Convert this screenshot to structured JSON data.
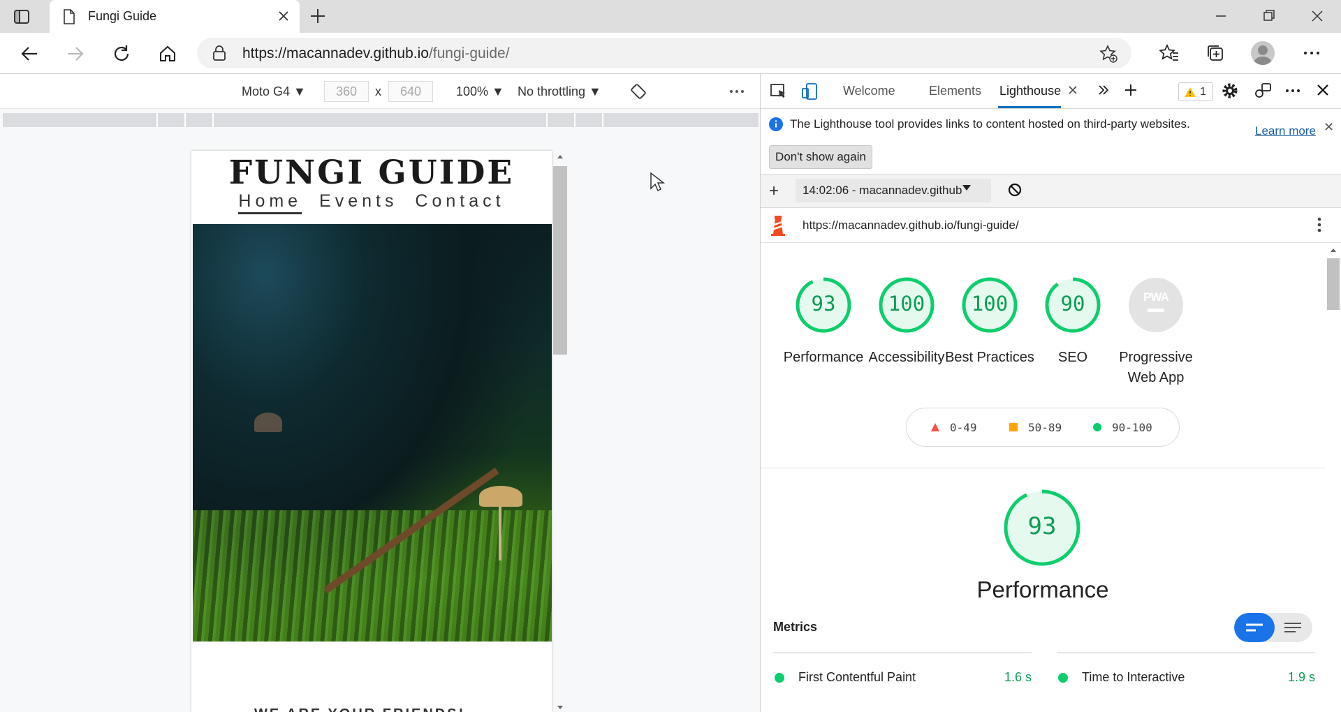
{
  "browser": {
    "tab_title": "Fungi Guide",
    "url_host": "https://macannadev.github.io",
    "url_path": "/fungi-guide/"
  },
  "device_toolbar": {
    "device": "Moto G4 ▼",
    "width": "360",
    "height": "640",
    "times": "x",
    "zoom": "100% ▼",
    "throttling": "No throttling ▼"
  },
  "site": {
    "title": "FUNGI GUIDE",
    "nav": [
      "Home",
      "Events",
      "Contact"
    ],
    "below_fold": "WE ARE YOUR FRIENDS!"
  },
  "devtools": {
    "tabs": {
      "welcome": "Welcome",
      "elements": "Elements",
      "lighthouse": "Lighthouse"
    },
    "warning_count": "1",
    "info_text": "The Lighthouse tool provides links to content hosted on third-party websites.",
    "learn_more": "Learn more",
    "dont_show": "Don't show again",
    "report_select": "14:02:06 - macannadev.github",
    "report_url": "https://macannadev.github.io/fungi-guide/",
    "scores": [
      {
        "label": "Performance",
        "value": 93
      },
      {
        "label": "Accessibility",
        "value": 100
      },
      {
        "label": "Best Practices",
        "value": 100
      },
      {
        "label": "SEO",
        "value": 90
      },
      {
        "label": "Progressive Web App",
        "value": null,
        "badge": "PWA"
      }
    ],
    "legend": {
      "fail": "0-49",
      "average": "50-89",
      "pass": "90-100"
    },
    "performance_score": "93",
    "performance_title": "Performance",
    "metrics_title": "Metrics",
    "metrics": [
      {
        "name": "First Contentful Paint",
        "value": "1.6 s"
      },
      {
        "name": "Time to Interactive",
        "value": "1.9 s"
      }
    ],
    "colors": {
      "pass": "#0cce6b",
      "average": "#ffa400",
      "fail": "#ff4e42",
      "accent": "#1a73e8"
    }
  }
}
